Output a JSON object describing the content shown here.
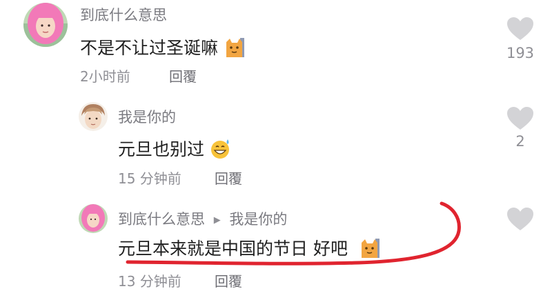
{
  "comments": [
    {
      "username": "到底什么意思",
      "text": "不是不让过圣诞嘛",
      "emoji": "cat-emoji",
      "time": "2小时前",
      "reply_label": "回覆",
      "likes": "193"
    },
    {
      "username": "我是你的",
      "text": "元旦也别过",
      "emoji": "grinning-sweat-emoji",
      "time": "15 分钟前",
      "reply_label": "回覆",
      "likes": "2"
    },
    {
      "username": "到底什么意思",
      "reply_to_arrow": "▶",
      "reply_to": "我是你的",
      "text": "元旦本来就是中国的节日 好吧",
      "emoji": "cat-emoji",
      "time": "13 分钟前",
      "reply_label": "回覆",
      "likes": ""
    }
  ],
  "colors": {
    "heart": "#d3d3d6",
    "annotation": "#e0242f",
    "avatar_pink_hair": "#f279b8"
  }
}
